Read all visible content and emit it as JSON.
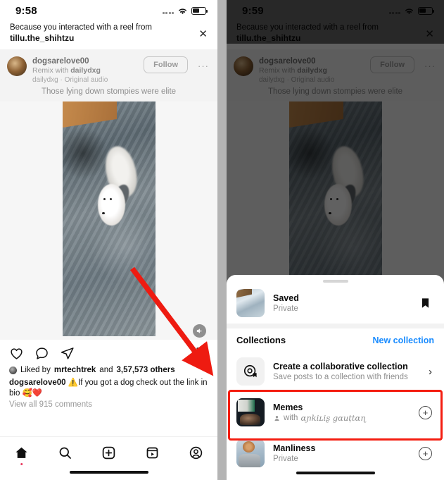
{
  "meta": {
    "accent_blue": "#1a8cff",
    "highlight_red": "#f41d10",
    "arrow_red": "#ee1b11"
  },
  "left": {
    "status": {
      "time": "9:58",
      "wifi": "wifi-icon",
      "battery": "battery-icon",
      "signal": "cellular-signal-icon"
    },
    "banner": {
      "line1": "Because you interacted with a reel from",
      "line2": "tillu.the_shihtzu",
      "close": "✕"
    },
    "post": {
      "username": "dogsarelove00",
      "remix_prefix": "Remix with ",
      "remix_user": "dailydxg",
      "audio": "dailydxg · Original audio",
      "follow_label": "Follow",
      "more": "···",
      "overlay_caption": "Those lying down stompies were elite"
    },
    "actions": {
      "like": "heart-icon",
      "comment": "comment-icon",
      "share": "share-icon",
      "save": "bookmark-icon",
      "volume": "volume-icon"
    },
    "likes": {
      "prefix": "Liked by ",
      "user": "mrtechtrek",
      "mid": " and ",
      "count": "3,57,573 others"
    },
    "caption": {
      "user": "dogsarelove00",
      "warn": "⚠️",
      "text": "If you got a dog check out the link in bio 🥰❤️"
    },
    "view_comments": "View all 915 comments",
    "tabs": [
      {
        "name": "home",
        "icon": "home-icon",
        "active": true
      },
      {
        "name": "search",
        "icon": "search-icon",
        "active": false
      },
      {
        "name": "create",
        "icon": "plus-square-icon",
        "active": false
      },
      {
        "name": "reels",
        "icon": "reels-icon",
        "active": false
      },
      {
        "name": "profile",
        "icon": "profile-icon",
        "active": false
      }
    ]
  },
  "right": {
    "status": {
      "time": "9:59"
    },
    "sheet": {
      "saved": {
        "title": "Saved",
        "subtitle": "Private",
        "icon": "bookmark-filled-icon"
      },
      "collections_header": {
        "title": "Collections",
        "action": "New collection"
      },
      "collab": {
        "title": "Create a collaborative collection",
        "subtitle": "Save posts to a collection with friends",
        "icon": "collaborative-collection-icon",
        "chevron": "›"
      },
      "items": [
        {
          "title": "Memes",
          "subtitle_prefix": "with ",
          "subtitle_user": "ɑɲkiʟiʂ gɑuțtɑɳ",
          "shared": true,
          "add": "+",
          "highlighted": true
        },
        {
          "title": "Manliness",
          "subtitle": "Private",
          "shared": false,
          "add": "+",
          "highlighted": false
        }
      ]
    }
  }
}
